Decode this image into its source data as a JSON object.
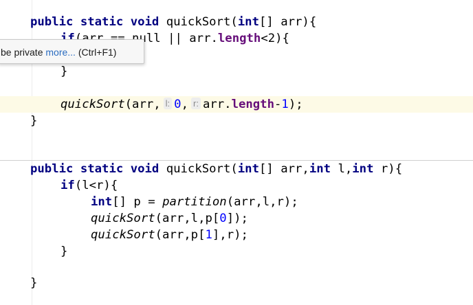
{
  "tooltip": {
    "text": "be private",
    "more_link": "more...",
    "shortcut": "(Ctrl+F1)"
  },
  "colors": {
    "keyword": "#000080",
    "field": "#660e7a",
    "number": "#0000ff",
    "caret_line": "#fdfae6",
    "link": "#2a6cc0"
  },
  "code": {
    "l1": {
      "kw1": "public",
      "kw2": "static",
      "kw3": "void",
      "name": "quickSort(",
      "kw4": "int",
      "rest": "[] arr){"
    },
    "l2": {
      "kw": "if",
      "visible": "(arr == null || arr.",
      "fld": "length",
      "rest": "<2){"
    },
    "l3": {
      "brace": "}"
    },
    "l4": {
      "call": "quickSort",
      "open": "(arr,",
      "hint_l": "l:",
      "num0": "0",
      "comma": ",",
      "hint_r": "r:",
      "arr": "arr.",
      "fld": "length",
      "minus": "-",
      "num1": "1",
      "close": ");"
    },
    "l5": {
      "brace": "}"
    },
    "l6": {
      "kw1": "public",
      "kw2": "static",
      "kw3": "void",
      "name": "quickSort(",
      "kw4": "int",
      "mid": "[] arr,",
      "kw5": "int",
      "p1": " l,",
      "kw6": "int",
      "p2": " r){"
    },
    "l7": {
      "kw": "if",
      "rest": "(l<r){"
    },
    "l8": {
      "kw": "int",
      "mid": "[] p = ",
      "call": "partition",
      "rest": "(arr,l,r);"
    },
    "l9": {
      "call": "quickSort",
      "open": "(arr,l,p[",
      "num": "0",
      "close": "]);"
    },
    "l10": {
      "call": "quickSort",
      "open": "(arr,p[",
      "num": "1",
      "close": "],r);"
    },
    "l11": {
      "brace": "}"
    },
    "l12": {
      "brace": "}"
    }
  }
}
